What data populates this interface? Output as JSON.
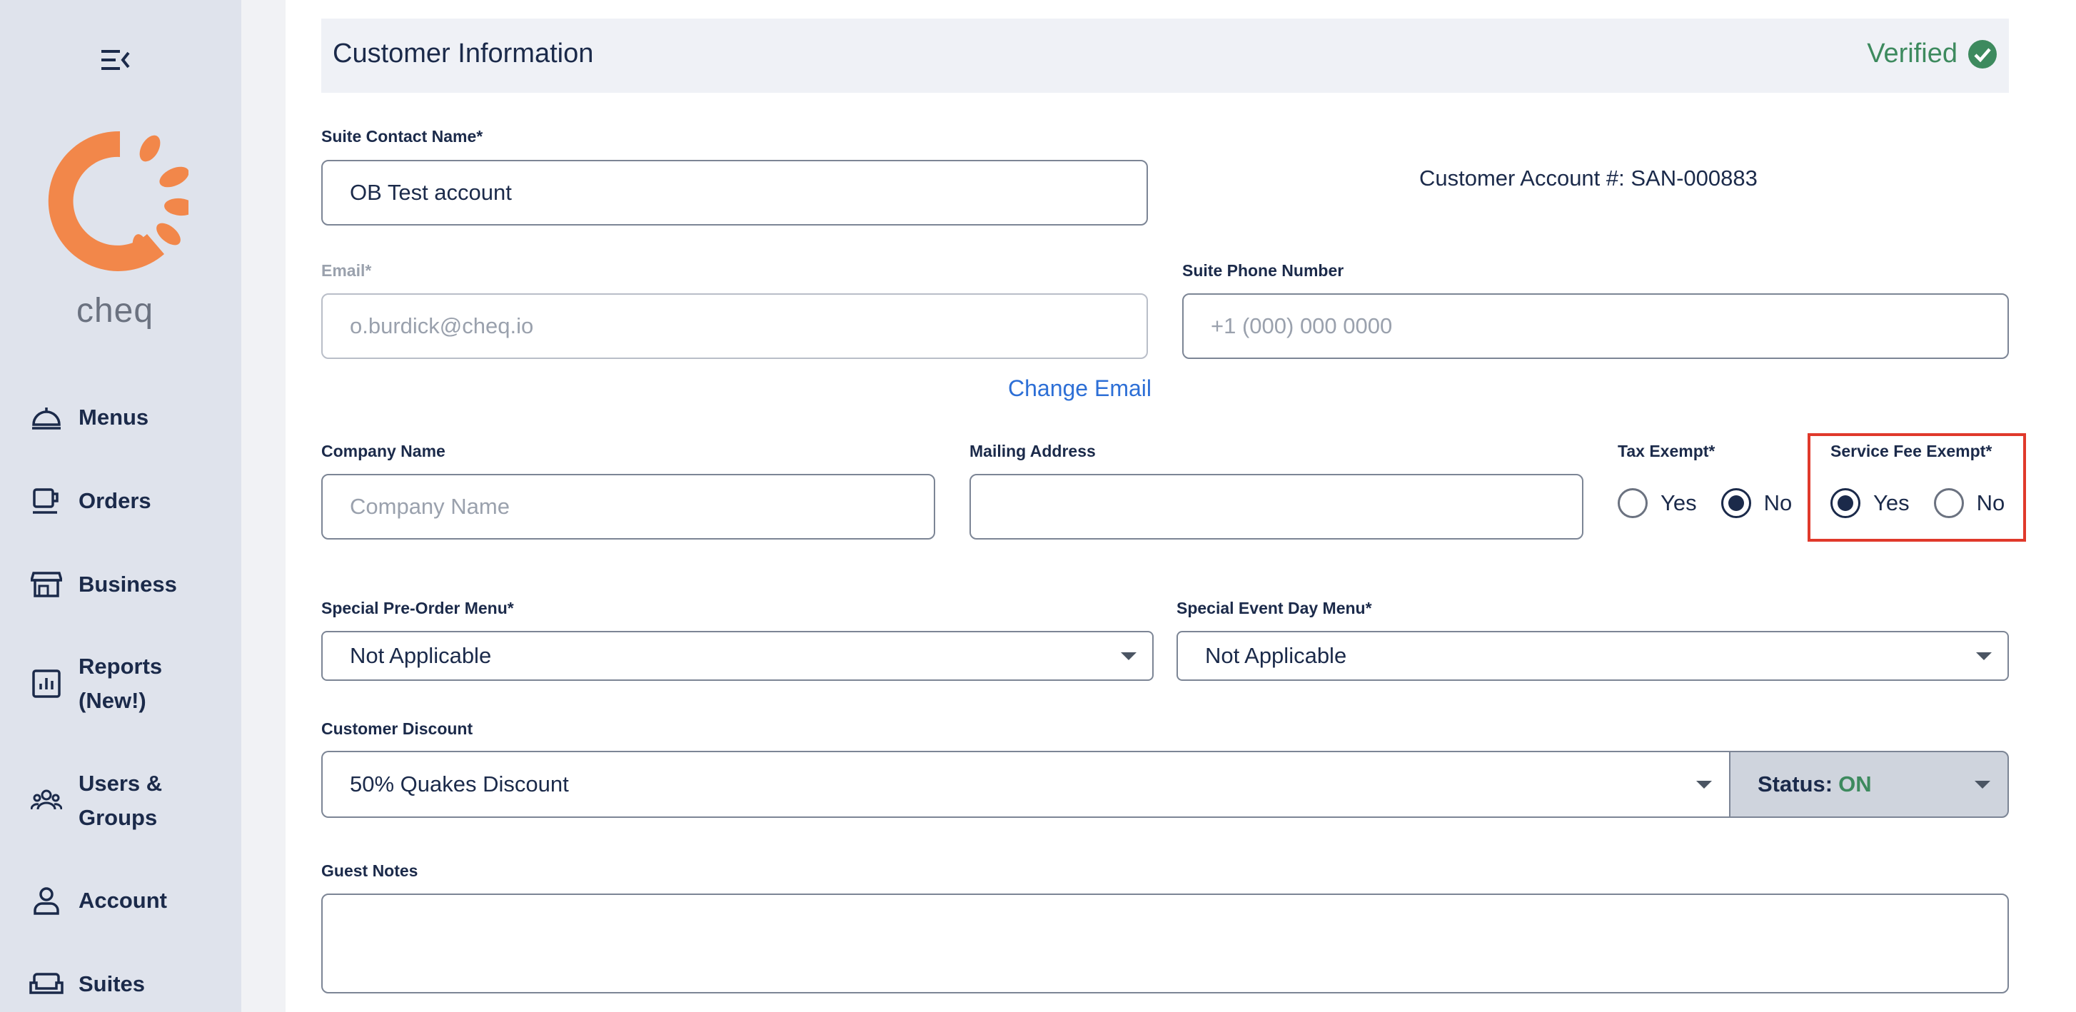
{
  "sidebar": {
    "brand": "cheq",
    "items": [
      {
        "label": "Menus",
        "icon": "cloche-icon"
      },
      {
        "label": "Orders",
        "icon": "cup-icon"
      },
      {
        "label": "Business",
        "icon": "storefront-icon"
      },
      {
        "label": "Reports (New!)",
        "icon": "report-chart-icon"
      },
      {
        "label": "Users & Groups",
        "icon": "users-group-icon"
      },
      {
        "label": "Account",
        "icon": "person-icon"
      },
      {
        "label": "Suites",
        "icon": "sofa-icon"
      }
    ]
  },
  "section": {
    "title": "Customer Information",
    "verified_label": "Verified"
  },
  "form": {
    "contact_name_label": "Suite Contact Name*",
    "contact_name_value": "OB Test account",
    "account_number": "Customer Account #: SAN-000883",
    "email_label": "Email*",
    "email_value": "o.burdick@cheq.io",
    "phone_label": "Suite Phone Number",
    "phone_placeholder": "+1 (000) 000 0000",
    "change_email": "Change Email",
    "company_label": "Company Name",
    "company_placeholder": "Company Name",
    "mailing_label": "Mailing Address",
    "mailing_value": "",
    "tax_exempt_label": "Tax Exempt*",
    "tax_exempt_options": [
      "Yes",
      "No"
    ],
    "tax_exempt_selected": "No",
    "service_fee_label": "Service Fee Exempt*",
    "service_fee_options": [
      "Yes",
      "No"
    ],
    "service_fee_selected": "Yes",
    "preorder_label": "Special Pre-Order Menu*",
    "preorder_value": "Not Applicable",
    "eventday_label": "Special Event Day Menu*",
    "eventday_value": "Not Applicable",
    "discount_label": "Customer Discount",
    "discount_value": "50% Quakes Discount",
    "status_label": "Status:",
    "status_value": "ON",
    "guest_notes_label": "Guest Notes",
    "guest_notes_value": ""
  },
  "colors": {
    "sidebar_bg": "#dfe3ec",
    "brand_orange": "#f2874a",
    "verified_green": "#3d8a5e",
    "link_blue": "#2d6fd6",
    "highlight_red": "#e0392b"
  }
}
